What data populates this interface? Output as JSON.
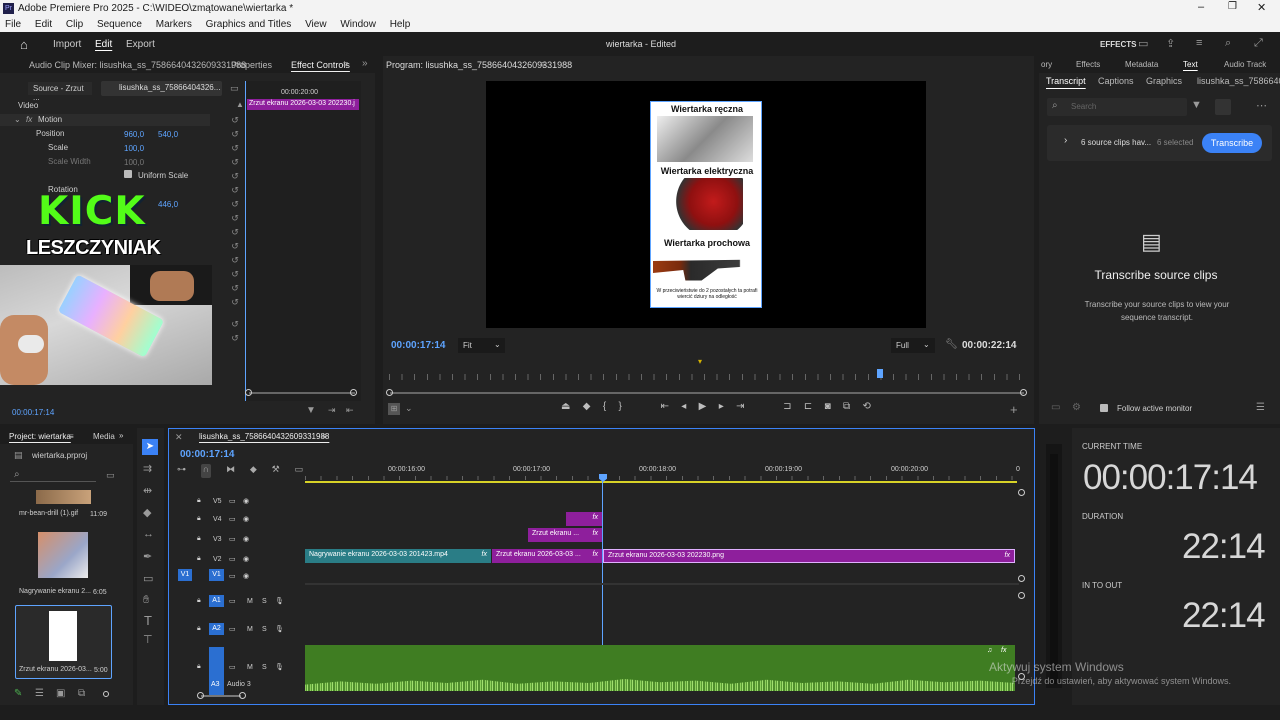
{
  "window": {
    "title": "Adobe Premiere Pro 2025 - C:\\WIDEO\\zmątowane\\wiertarka *",
    "menu": [
      "File",
      "Edit",
      "Clip",
      "Sequence",
      "Markers",
      "Graphics and Titles",
      "View",
      "Window",
      "Help"
    ]
  },
  "workspace": {
    "tabs": [
      "Import",
      "Edit",
      "Export"
    ],
    "active_tab": "Edit",
    "project_title": "wiertarka - Edited",
    "effects_label": "EFFECTS"
  },
  "left_panel": {
    "tabs": [
      "Audio Clip Mixer: lisushka_ss_7586640432609331988",
      "Properties",
      "Effect Controls"
    ],
    "source_tab": "Source - Zrzut ...",
    "sequence_tab": "lisushka_ss_75866404326...",
    "section": "Video",
    "fx_motion": "Motion",
    "rows": [
      {
        "label": "Position",
        "v1": "960,0",
        "v2": "540,0"
      },
      {
        "label": "Scale",
        "v1": "100,0",
        "v2": ""
      },
      {
        "label": "Scale Width",
        "v1": "100,0",
        "v2": ""
      },
      {
        "label": "Uniform Scale",
        "v1": "",
        "v2": ""
      },
      {
        "label": "Rotation",
        "v1": "0,0",
        "v2": ""
      }
    ],
    "extra_value": "446,0",
    "timecode_head": "00:00:20:00",
    "mini_clip": "Zrzut ekranu 2026-03-03 202230.j",
    "current_time": "00:00:17:14"
  },
  "overlay": {
    "kick": "KICK",
    "name": "LESZCZYNIAK"
  },
  "program": {
    "title": "Program: lisushka_ss_7586640432609331988",
    "timecode": "00:00:17:14",
    "fit": "Fit",
    "full": "Full",
    "duration": "00:00:22:14",
    "captions": [
      "Wiertarka ręczna",
      "Wiertarka elektryczna",
      "Wiertarka prochowa"
    ],
    "footnote": "W przeciwieństwie do 2 pozostałych ta potrafi wiercić dziury na odległość"
  },
  "right_panel": {
    "top_tabs": [
      "ory",
      "Effects",
      "Metadata",
      "Text",
      "Audio Track"
    ],
    "sub_tabs": [
      "Transcript",
      "Captions",
      "Graphics",
      "lisushka_ss_75866404"
    ],
    "search_placeholder": "Search",
    "source_clips": "6 source clips hav...",
    "selected": "6 selected",
    "transcribe_button": "Transcribe",
    "heading": "Transcribe source clips",
    "body": "Transcribe your source clips to view your sequence transcript.",
    "follow": "Follow active monitor"
  },
  "project": {
    "tabs": [
      "Project: wiertarka",
      "Media"
    ],
    "file": "wiertarka.prproj",
    "items": [
      {
        "name": "mr-bean-drill (1).gif",
        "dur": "11:09"
      },
      {
        "name": "Nagrywanie ekranu 2...",
        "dur": "6:05"
      },
      {
        "name": "Zrzut ekranu 2026-03...",
        "dur": "5:00"
      }
    ]
  },
  "timeline": {
    "title": "lisushka_ss_7586640432609331988",
    "timecode": "00:00:17:14",
    "ruler": [
      "00:00:16:00",
      "00:00:17:00",
      "00:00:18:00",
      "00:00:19:00",
      "00:00:20:00"
    ],
    "ruler_end": "0",
    "video_tracks": [
      "V5",
      "V4",
      "V3",
      "V2",
      "V1"
    ],
    "audio_tracks": [
      "A1",
      "A2",
      "A3"
    ],
    "audio3_name": "Audio 3",
    "clips": {
      "v2_a": "Nagrywanie ekranu 2026-03-03 201423.mp4",
      "v2_b": "Zrzut ekranu 2026-03-03 ...",
      "v2_c": "Zrzut ekranu 2026-03-03 202230.png",
      "v3": "Zrzut ekranu ..."
    },
    "fx": "fx",
    "m": "M",
    "s": "S"
  },
  "time_panel": {
    "current_label": "CURRENT TIME",
    "current_value": "00:00:17:14",
    "duration_label": "DURATION",
    "duration_value": "22:14",
    "inout_label": "IN TO OUT",
    "inout_value": "22:14"
  },
  "watermark": {
    "line1": "Aktywuj system Windows",
    "line2": "Przejdź do ustawień, aby aktywować system Windows."
  },
  "colors": {
    "clip_teal": "#2a7d86",
    "clip_magenta": "#8e1f9c",
    "audio_green": "#3f7d22",
    "accent_blue": "#3b82f6",
    "playhead": "#5ea4ff",
    "kick_green": "#53fc18"
  }
}
